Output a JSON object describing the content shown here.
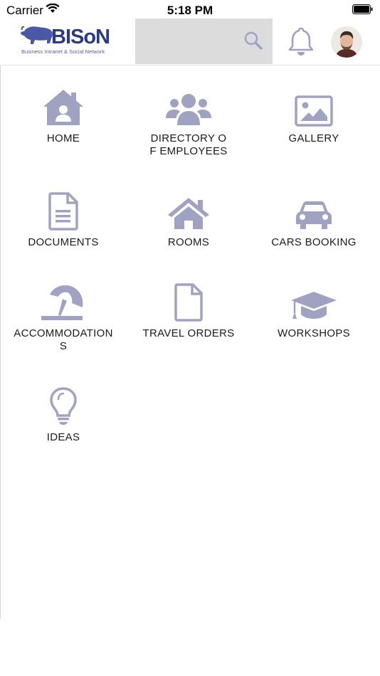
{
  "status_bar": {
    "carrier": "Carrier",
    "time": "5:18 PM"
  },
  "header": {
    "logo_text": "BISoN",
    "logo_subtitle": "Business Intranet & Social Network"
  },
  "menu": [
    {
      "label": "HOME",
      "icon": "home-icon"
    },
    {
      "label": "DIRECTORY OF EMPLOYEES",
      "icon": "users-icon"
    },
    {
      "label": "GALLERY",
      "icon": "image-icon"
    },
    {
      "label": "DOCUMENTS",
      "icon": "document-icon"
    },
    {
      "label": "ROOMS",
      "icon": "house-icon"
    },
    {
      "label": "CARS BOOKING",
      "icon": "car-icon"
    },
    {
      "label": "ACCOMMODATIONS",
      "icon": "beach-umbrella-icon"
    },
    {
      "label": "TRAVEL ORDERS",
      "icon": "file-icon"
    },
    {
      "label": "WORKSHOPS",
      "icon": "graduation-cap-icon"
    },
    {
      "label": "IDEAS",
      "icon": "lightbulb-icon"
    }
  ],
  "colors": {
    "icon": "#9fa3c1",
    "brand": "#2f3a84",
    "search_bg": "#dcdcdc"
  }
}
